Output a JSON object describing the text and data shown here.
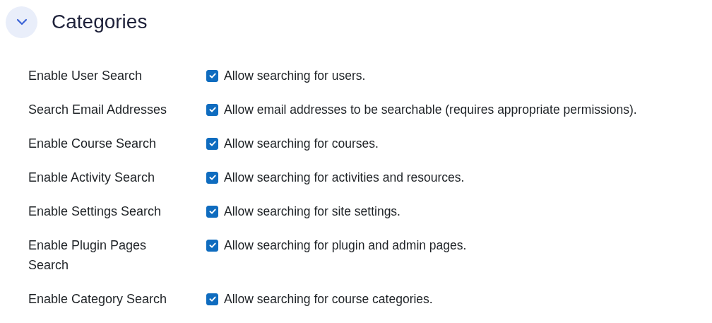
{
  "section": {
    "title": "Categories",
    "expanded": true
  },
  "settings": [
    {
      "label": "Enable User Search",
      "description": "Allow searching for users.",
      "checked": true
    },
    {
      "label": "Search Email Addresses",
      "description": "Allow email addresses to be searchable (requires appropriate permissions).",
      "checked": true
    },
    {
      "label": "Enable Course Search",
      "description": "Allow searching for courses.",
      "checked": true
    },
    {
      "label": "Enable Activity Search",
      "description": "Allow searching for activities and resources.",
      "checked": true
    },
    {
      "label": "Enable Settings Search",
      "description": "Allow searching for site settings.",
      "checked": true
    },
    {
      "label": "Enable Plugin Pages Search",
      "description": "Allow searching for plugin and admin pages.",
      "checked": true
    },
    {
      "label": "Enable Category Search",
      "description": "Allow searching for course categories.",
      "checked": true
    }
  ]
}
